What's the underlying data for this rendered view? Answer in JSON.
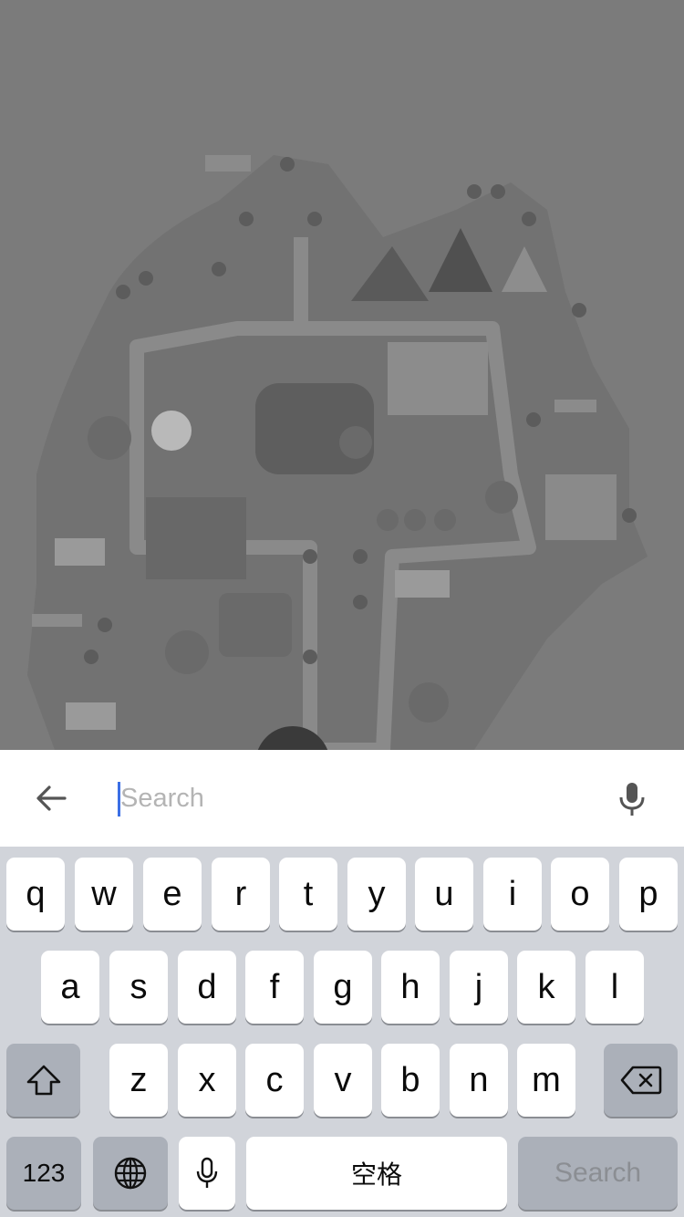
{
  "search": {
    "placeholder": "Search"
  },
  "icons": {
    "back": "arrow-left-icon",
    "voice": "microphone-icon",
    "shift": "shift-icon",
    "delete": "backspace-icon",
    "globe": "globe-icon",
    "dictation": "microphone-icon"
  },
  "keyboard": {
    "row1": [
      "q",
      "w",
      "e",
      "r",
      "t",
      "y",
      "u",
      "i",
      "o",
      "p"
    ],
    "row2": [
      "a",
      "s",
      "d",
      "f",
      "g",
      "h",
      "j",
      "k",
      "l"
    ],
    "row3": [
      "z",
      "x",
      "c",
      "v",
      "b",
      "n",
      "m"
    ],
    "numbers_label": "123",
    "space_label": "空格",
    "search_label": "Search"
  },
  "colors": {
    "caret": "#3b6fe5",
    "keyboard_bg": "#d1d4da",
    "key_bg": "#ffffff",
    "dark_key_bg": "#abb0b9",
    "overlay": "#7b7b7b"
  }
}
